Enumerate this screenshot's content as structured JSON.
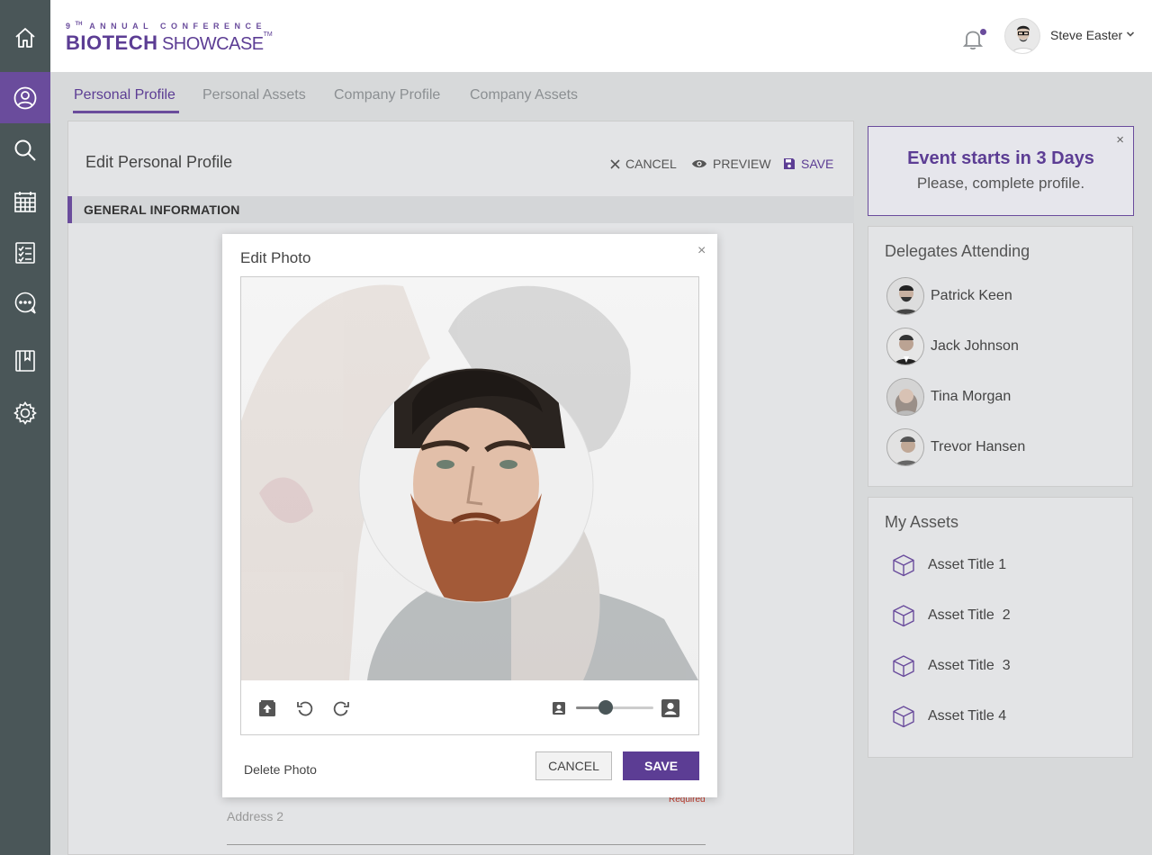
{
  "logo": {
    "tagline_num": "9",
    "tagline_sup": "TH",
    "tagline": "ANNUAL CONFERENCE",
    "brand_bold": "BIOTECH",
    "brand_light": "SHOWCASE",
    "brand_tm": "TM"
  },
  "header": {
    "user_name": "Steve Easter"
  },
  "sidebar": {
    "items": [
      "home-icon",
      "profile-icon",
      "search-icon",
      "calendar-icon",
      "checklist-icon",
      "chat-icon",
      "book-icon",
      "gear-icon"
    ],
    "active": "profile-icon"
  },
  "tabs": [
    "Personal Profile",
    "Personal Assets",
    "Company Profile",
    "Company Assets"
  ],
  "card": {
    "title": "Edit Personal Profile",
    "actions": {
      "cancel": "CANCEL",
      "preview": "PREVIEW",
      "save": "SAVE"
    },
    "section": "GENERAL INFORMATION",
    "required": "Required",
    "address2_placeholder": "Address 2"
  },
  "modal": {
    "title": "Edit Photo",
    "close": "×",
    "delete": "Delete Photo",
    "cancel": "CANCEL",
    "save": "SAVE",
    "zoom_fraction": 0.38
  },
  "event": {
    "title": "Event starts in 3 Days",
    "subtitle": "Please, complete profile.",
    "close": "×"
  },
  "delegates": {
    "title": "Delegates Attending",
    "people": [
      "Patrick Keen",
      "Jack Johnson",
      "Tina Morgan",
      "Trevor Hansen"
    ]
  },
  "assets": {
    "title": "My Assets",
    "items": [
      "Asset Title 1",
      "Asset Title  2",
      "Asset Title  3",
      "Asset Title 4"
    ]
  },
  "colors": {
    "accent": "#6a4c9c",
    "sidebar": "#4a5658",
    "background": "#d7d9da"
  }
}
